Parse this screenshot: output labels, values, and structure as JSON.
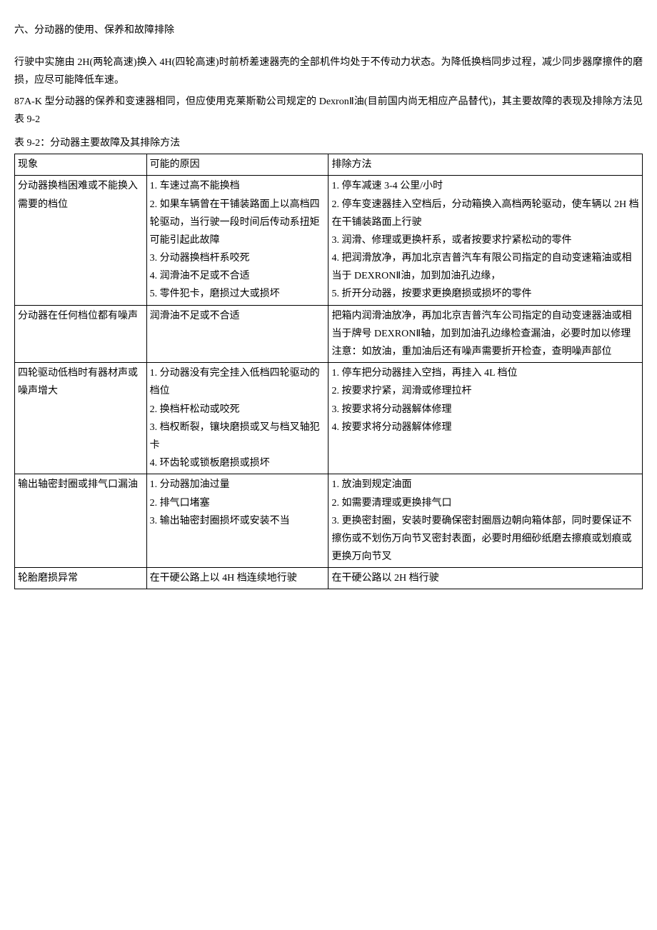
{
  "title": "六、分动器的使用、保养和故障排除",
  "para1": "行驶中实施由 2H(两轮高速)换入 4H(四轮高速)时前桥差速器壳的全部机件均处于不传动力状态。为降低换档同步过程，减少同步器摩擦件的磨损，应尽可能降低车速。",
  "para2": "87A-K 型分动器的保养和变速器相同，但应使用克莱斯勒公司规定的 DexronⅡ油(目前国内尚无相应产品替代)，其主要故障的表现及排除方法见表 9-2",
  "tableCaption": "表 9-2：分动器主要故障及其排除方法",
  "header": {
    "c1": "现象",
    "c2": "可能的原因",
    "c3": "排除方法"
  },
  "rows": [
    {
      "c1": "分动器换档困难或不能换入需要的档位",
      "c2": "1. 车速过高不能换档\n2. 如果车辆曾在干铺装路面上以高档四轮驱动，当行驶一段时间后传动系扭矩可能引起此故障\n3. 分动器换档杆系咬死\n4. 润滑油不足或不合适\n5. 零件犯卡，磨损过大或损坏",
      "c3": "1. 停车减速 3-4 公里/小时\n2. 停车变速器挂入空档后，分动箱换入高档两轮驱动，使车辆以 2H 档在干铺装路面上行驶\n3. 润滑、修理或更换杆系，或者按要求拧紧松动的零件\n4. 把润滑放净，再加北京吉普汽车有限公司指定的自动变速箱油或相当于 DEXRONⅡ油，加到加油孔边缘，\n5. 折开分动器，按要求更换磨损或损坏的零件"
    },
    {
      "c1": "分动器在任何档位都有噪声",
      "c2": "润滑油不足或不合适",
      "c3": "把箱内润滑油放净，再加北京吉普汽车公司指定的自动变速器油或相当于牌号 DEXRONⅡ轴，加到加油孔边缘检查漏油，必要时加以修理注意：如放油，重加油后还有噪声需要折开检查，查明噪声部位"
    },
    {
      "c1": "四轮驱动低档时有器材声或噪声增大",
      "c2": "1. 分动器没有完全挂入低档四轮驱动的档位\n2. 换档杆松动或咬死\n3. 档权断裂，镶块磨损或叉与档叉轴犯卡\n4. 环齿轮或锁板磨损或损坏",
      "c3": "1. 停车把分动器挂入空挡，再挂入 4L 档位\n2. 按要求拧紧，润滑或修理拉杆\n3. 按要求将分动器解体修理\n4. 按要求将分动器解体修理"
    },
    {
      "c1": "输出轴密封圈或排气口漏油",
      "c2": "1. 分动器加油过量\n2. 排气口堵塞\n3. 输出轴密封圈损坏或安装不当",
      "c3": "1. 放油到规定油面\n2. 如需要清理或更换排气口\n3. 更换密封圈，安装时要确保密封圈唇边朝向箱体部，同时要保证不擦伤或不划伤万向节叉密封表面，必要时用细砂纸磨去擦痕或划痕或更换万向节叉"
    },
    {
      "c1": "轮胎磨损异常",
      "c2": "在干硬公路上以 4H 档连续地行驶",
      "c3": "在干硬公路以 2H 档行驶"
    }
  ]
}
